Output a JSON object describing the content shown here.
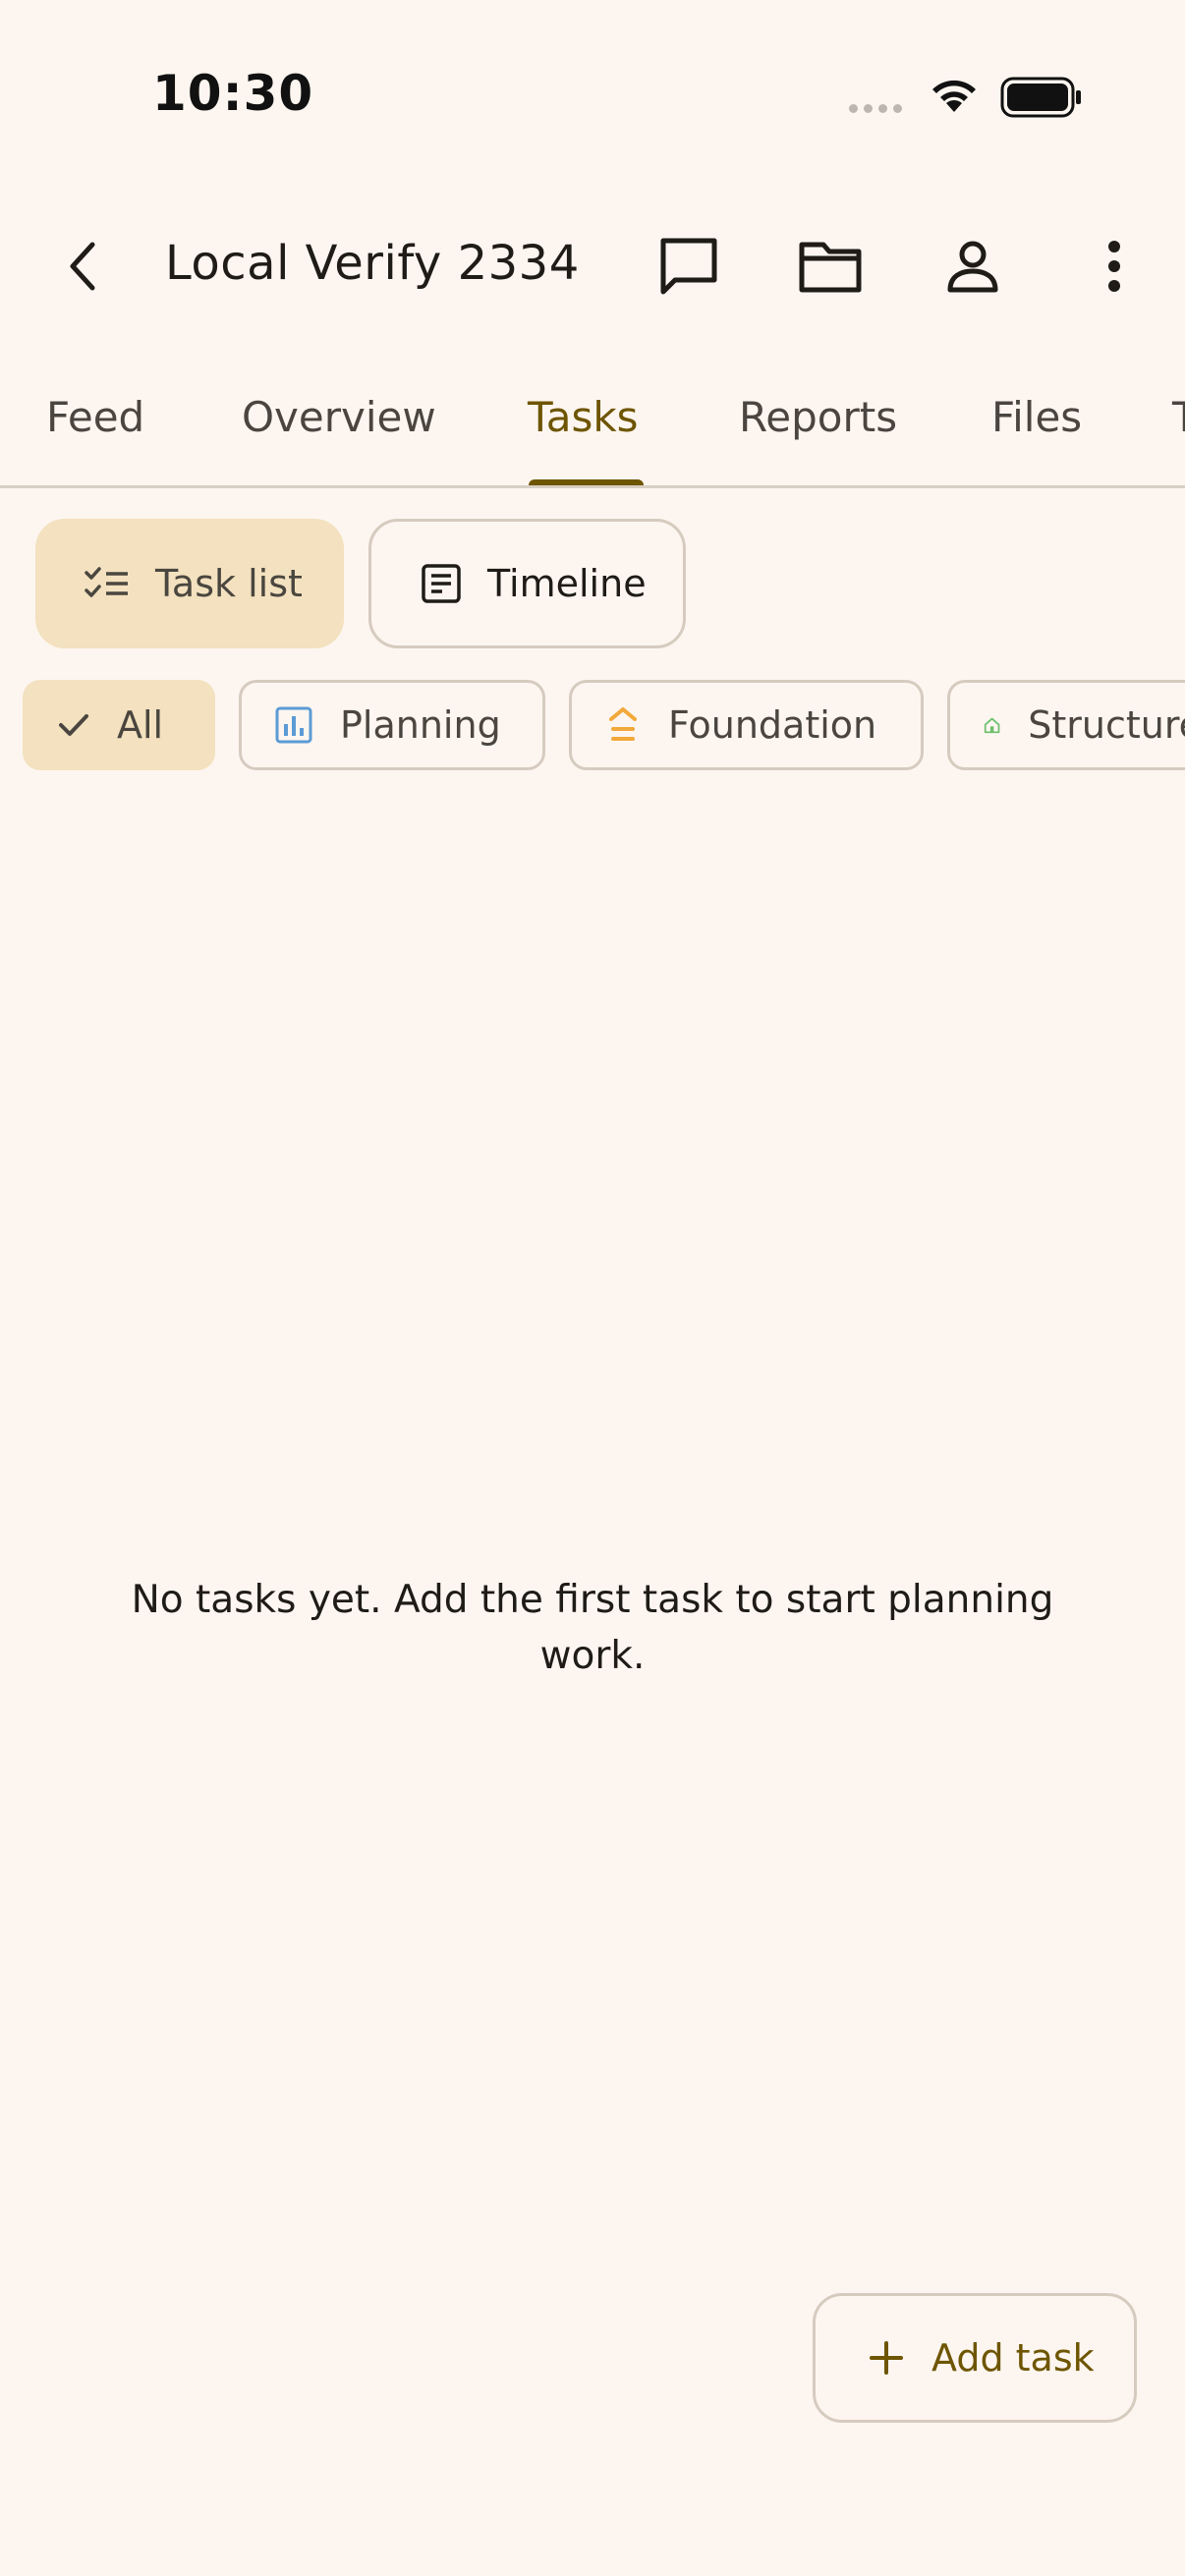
{
  "status": {
    "time": "10:30"
  },
  "app_bar": {
    "title": "Local Verify 2334"
  },
  "tabs": [
    {
      "label": "Feed"
    },
    {
      "label": "Overview"
    },
    {
      "label": "Tasks",
      "active": true
    },
    {
      "label": "Reports"
    },
    {
      "label": "Files"
    },
    {
      "label": "T"
    }
  ],
  "view_toggle": {
    "task_list": "Task list",
    "timeline": "Timeline",
    "selected": "Task list"
  },
  "filters": [
    {
      "label": "All",
      "selected": true
    },
    {
      "label": "Planning",
      "icon": "chart-icon",
      "color": "#5b9bd5"
    },
    {
      "label": "Foundation",
      "icon": "foundation-icon",
      "color": "#f2a93b"
    },
    {
      "label": "Structure",
      "icon": "house-icon",
      "color": "#6cbf6c"
    }
  ],
  "empty_state": {
    "message": "No tasks yet. Add the first task to start planning work."
  },
  "fab": {
    "label": "Add task"
  },
  "colors": {
    "accent": "#6e5500",
    "selected_bg": "#f3e1bf",
    "background": "#fdf6f0",
    "outline": "#d6cbbf"
  }
}
